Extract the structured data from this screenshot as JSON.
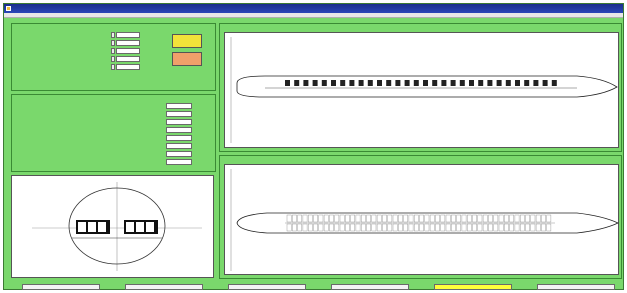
{
  "window": {
    "title": "",
    "menu": []
  },
  "inputs_panel": {
    "title": "",
    "rows": [
      {
        "label": "",
        "value": ""
      },
      {
        "label": "",
        "value": ""
      },
      {
        "label": "",
        "value": ""
      },
      {
        "label": "",
        "value": ""
      },
      {
        "label": "",
        "value": ""
      }
    ],
    "buttons": [
      {
        "label": "",
        "color": "#f2e23a"
      },
      {
        "label": "",
        "color": "#f0a06a"
      }
    ]
  },
  "outputs_panel": {
    "title": "",
    "rows": [
      {
        "label": "",
        "value": ""
      },
      {
        "label": "",
        "value": ""
      },
      {
        "label": "",
        "value": ""
      },
      {
        "label": "",
        "value": ""
      },
      {
        "label": "",
        "value": ""
      },
      {
        "label": "",
        "value": ""
      },
      {
        "label": "",
        "value": ""
      },
      {
        "label": "",
        "value": ""
      }
    ]
  },
  "cross_section": {
    "left_caption": "",
    "right_caption": ""
  },
  "external_view": {
    "title": "",
    "window_count": 30
  },
  "floor_plan": {
    "title": "",
    "seat_columns": 50
  },
  "bottom_buttons": [
    {
      "label": "",
      "highlight": false
    },
    {
      "label": "",
      "highlight": false
    },
    {
      "label": "",
      "highlight": false
    },
    {
      "label": "",
      "highlight": false
    },
    {
      "label": "",
      "highlight": true
    },
    {
      "label": "",
      "highlight": false
    }
  ]
}
